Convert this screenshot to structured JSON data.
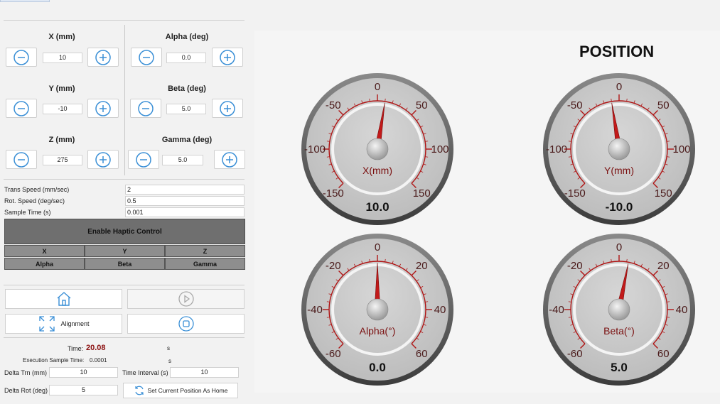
{
  "controls": {
    "x": {
      "label": "X (mm)",
      "value": "10"
    },
    "y": {
      "label": "Y (mm)",
      "value": "-10"
    },
    "z": {
      "label": "Z (mm)",
      "value": "275"
    },
    "alpha": {
      "label": "Alpha (deg)",
      "value": "0.0"
    },
    "beta": {
      "label": "Beta (deg)",
      "value": "5.0"
    },
    "gamma": {
      "label": "Gamma (deg)",
      "value": "5.0"
    }
  },
  "params": {
    "trans_speed_label": "Trans Speed (mm/sec)",
    "trans_speed": "2",
    "rot_speed_label": "Rot. Speed (deg/sec)",
    "rot_speed": "0.5",
    "sample_time_label": "Sample Time (s)",
    "sample_time": "0.001"
  },
  "haptic": {
    "label": "Enable Haptic Control",
    "axes": [
      "X",
      "Y",
      "Z",
      "Alpha",
      "Beta",
      "Gamma"
    ]
  },
  "actions": {
    "alignment_label": "Alignment",
    "set_home_label": "Set Current Position As Home"
  },
  "status": {
    "time_label": "Time:",
    "time_value": "20.08",
    "time_unit": "s",
    "exec_label": "Execution Sample Time:",
    "exec_value": "0.0001",
    "exec_unit": "s",
    "delta_trn_label": "Delta Trn (mm)",
    "delta_trn": "10",
    "time_interval_label": "Time Interval (s)",
    "time_interval": "10",
    "delta_rot_label": "Delta Rot (deg)",
    "delta_rot": "5"
  },
  "position": {
    "title": "POSITION",
    "gauges": [
      {
        "name": "X(mm)",
        "value": 10.0,
        "display": "10.0",
        "ticks": [
          -150,
          -100,
          -50,
          0,
          50,
          100,
          150
        ]
      },
      {
        "name": "Y(mm)",
        "value": -10.0,
        "display": "-10.0",
        "ticks": [
          -150,
          -100,
          -50,
          0,
          50,
          100,
          150
        ]
      },
      {
        "name": "Alpha(°)",
        "value": 0.0,
        "display": "0.0",
        "ticks": [
          -60,
          -40,
          -20,
          0,
          20,
          40,
          60
        ]
      },
      {
        "name": "Beta(°)",
        "value": 5.0,
        "display": "5.0",
        "ticks": [
          -60,
          -40,
          -20,
          0,
          20,
          40,
          60
        ]
      }
    ]
  },
  "colors": {
    "gauge_red": "#b01515",
    "needle": "#c21a1a",
    "haptic_bg": "#6f6f6f",
    "axis_btn_bg": "#8e8e8e",
    "icon_blue": "#3a8fd6"
  }
}
